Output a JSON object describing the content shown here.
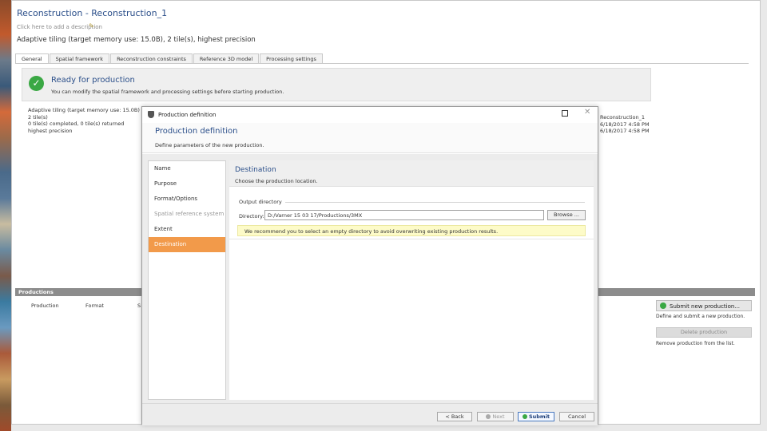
{
  "window": {
    "title": "Reconstruction - Reconstruction_1",
    "subtitle": "Click here to add a description",
    "settings_line": "Adaptive tiling (target memory use: 15.0B), 2 tile(s), highest precision"
  },
  "tabs": [
    {
      "label": "General"
    },
    {
      "label": "Spatial framework"
    },
    {
      "label": "Reconstruction constraints"
    },
    {
      "label": "Reference 3D model"
    },
    {
      "label": "Processing settings"
    }
  ],
  "ready": {
    "title": "Ready for production",
    "subtitle": "You can modify the spatial framework and processing settings before starting production."
  },
  "info_left": [
    "Adaptive tiling (target memory use: 15.0B)",
    "2 tile(s)",
    "0 tile(s) completed, 0 tile(s) returned",
    "highest precision"
  ],
  "info_right": [
    "Reconstruction_1",
    "6/18/2017 4:58 PM",
    "6/18/2017 4:58 PM"
  ],
  "productions": {
    "title": "Productions",
    "col_name": "Production",
    "col_format": "Format",
    "col_status": "S",
    "submit_new_label": "Submit new production...",
    "submit_new_desc": "Define and submit a new production.",
    "delete_label": "Delete production",
    "delete_desc": "Remove production from the list."
  },
  "dialog": {
    "title": "Production definition",
    "header_title": "Production definition",
    "header_sub": "Define parameters of the new production.",
    "nav": [
      {
        "label": "Name"
      },
      {
        "label": "Purpose"
      },
      {
        "label": "Format/Options"
      },
      {
        "label": "Spatial reference system"
      },
      {
        "label": "Extent"
      },
      {
        "label": "Destination"
      }
    ],
    "dest_title": "Destination",
    "dest_sub": "Choose the production location.",
    "group_label": "Output directory",
    "dir_label": "Directory:",
    "dir_value": "D:/Varner 15 03 17/Productions/3MX",
    "browse_label": "Browse ...",
    "hint": "We recommend you to select an empty directory to avoid overwriting existing production results.",
    "back_label": "< Back",
    "next_label": "Next",
    "submit_label": "Submit",
    "cancel_label": "Cancel"
  },
  "colors": {
    "accent": "#f29a4a",
    "title_blue": "#2b4f8a",
    "ok_green": "#3aa844",
    "hint_yellow": "#fdfbc8"
  }
}
